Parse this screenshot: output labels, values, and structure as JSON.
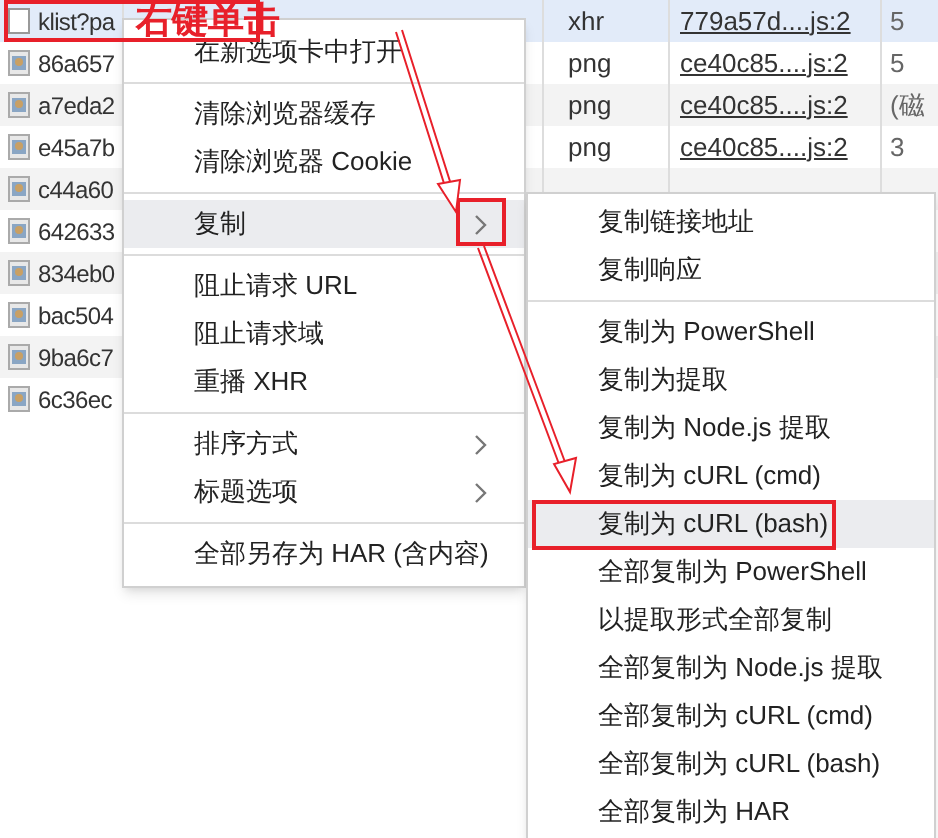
{
  "annotation": {
    "label": "右键单击"
  },
  "rows": [
    {
      "name": "klist?pa",
      "kind": "document",
      "selected": true,
      "type": "xhr",
      "initiator": "779a57d....js:2",
      "size": "5"
    },
    {
      "name": "86a657",
      "kind": "image",
      "selected": false,
      "type": "png",
      "initiator": "ce40c85....js:2",
      "size": "5"
    },
    {
      "name": "a7eda2",
      "kind": "image",
      "selected": false,
      "type": "png",
      "initiator": "ce40c85....js:2",
      "size": "(磁"
    },
    {
      "name": "e45a7b",
      "kind": "image",
      "selected": false,
      "type": "png",
      "initiator": "ce40c85....js:2",
      "size": "3"
    },
    {
      "name": "c44a60",
      "kind": "image",
      "selected": false
    },
    {
      "name": "642633",
      "kind": "image",
      "selected": false
    },
    {
      "name": "834eb0",
      "kind": "image",
      "selected": false
    },
    {
      "name": "bac504",
      "kind": "image",
      "selected": false
    },
    {
      "name": "9ba6c7",
      "kind": "image",
      "selected": false
    },
    {
      "name": "6c36ec",
      "kind": "image",
      "selected": false
    }
  ],
  "context_menu": [
    {
      "kind": "item",
      "label": "在新选项卡中打开",
      "submenu": false,
      "highlighted": false
    },
    {
      "kind": "divider"
    },
    {
      "kind": "item",
      "label": "清除浏览器缓存",
      "submenu": false,
      "highlighted": false
    },
    {
      "kind": "item",
      "label": "清除浏览器 Cookie",
      "submenu": false,
      "highlighted": false
    },
    {
      "kind": "divider"
    },
    {
      "kind": "item",
      "label": "复制",
      "submenu": true,
      "highlighted": true
    },
    {
      "kind": "divider"
    },
    {
      "kind": "item",
      "label": "阻止请求 URL",
      "submenu": false,
      "highlighted": false
    },
    {
      "kind": "item",
      "label": "阻止请求域",
      "submenu": false,
      "highlighted": false
    },
    {
      "kind": "item",
      "label": "重播 XHR",
      "submenu": false,
      "highlighted": false
    },
    {
      "kind": "divider"
    },
    {
      "kind": "item",
      "label": "排序方式",
      "submenu": true,
      "highlighted": false
    },
    {
      "kind": "item",
      "label": "标题选项",
      "submenu": true,
      "highlighted": false
    },
    {
      "kind": "divider"
    },
    {
      "kind": "item",
      "label": "全部另存为 HAR (含内容)",
      "submenu": false,
      "highlighted": false
    }
  ],
  "copy_submenu": [
    {
      "kind": "item",
      "label": "复制链接地址",
      "highlighted": false
    },
    {
      "kind": "item",
      "label": "复制响应",
      "highlighted": false
    },
    {
      "kind": "divider"
    },
    {
      "kind": "item",
      "label": "复制为 PowerShell",
      "highlighted": false
    },
    {
      "kind": "item",
      "label": "复制为提取",
      "highlighted": false
    },
    {
      "kind": "item",
      "label": "复制为 Node.js 提取",
      "highlighted": false
    },
    {
      "kind": "item",
      "label": "复制为 cURL (cmd)",
      "highlighted": false
    },
    {
      "kind": "item",
      "label": "复制为 cURL (bash)",
      "highlighted": true
    },
    {
      "kind": "item",
      "label": "全部复制为 PowerShell",
      "highlighted": false
    },
    {
      "kind": "item",
      "label": "以提取形式全部复制",
      "highlighted": false
    },
    {
      "kind": "item",
      "label": "全部复制为 Node.js 提取",
      "highlighted": false
    },
    {
      "kind": "item",
      "label": "全部复制为 cURL (cmd)",
      "highlighted": false
    },
    {
      "kind": "item",
      "label": "全部复制为 cURL (bash)",
      "highlighted": false
    },
    {
      "kind": "item",
      "label": "全部复制为 HAR",
      "highlighted": false
    }
  ]
}
